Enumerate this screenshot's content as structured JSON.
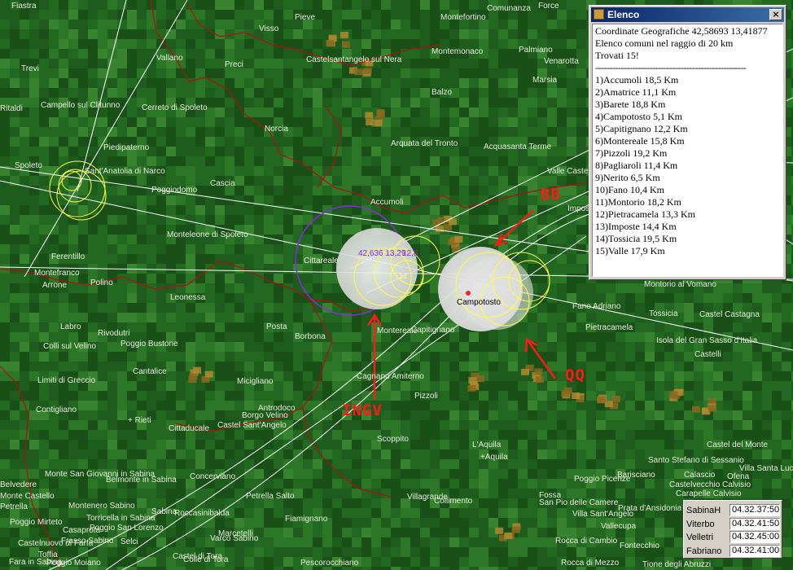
{
  "towns": [
    {
      "name": "Fiastra"
    },
    {
      "name": "Pieve"
    },
    {
      "name": "Visso"
    },
    {
      "name": "Montefortino"
    },
    {
      "name": "Comunanza"
    },
    {
      "name": "Force"
    },
    {
      "name": "Vallano"
    },
    {
      "name": "Preci"
    },
    {
      "name": "Castelsantangelo sul Nera"
    },
    {
      "name": "Montemonaco"
    },
    {
      "name": "Palmiano"
    },
    {
      "name": "Venarotta"
    },
    {
      "name": "Trevi"
    },
    {
      "name": "Marsia"
    },
    {
      "name": "Balzo"
    },
    {
      "name": "Ritaldi"
    },
    {
      "name": "Campello sul Clitunno"
    },
    {
      "name": "Cerreto di Spoleto"
    },
    {
      "name": "Norcia"
    },
    {
      "name": "Arquata del Tronto"
    },
    {
      "name": "Acquasanta Terme"
    },
    {
      "name": "Piedipaterno"
    },
    {
      "name": "Spoleto"
    },
    {
      "name": "Sant'Anatolia di Narco"
    },
    {
      "name": "Poggiodomo"
    },
    {
      "name": "Cascia"
    },
    {
      "name": "Valle Castellana"
    },
    {
      "name": "Accumoli"
    },
    {
      "name": "Imposte"
    },
    {
      "name": "Monteleone di Spoleto"
    },
    {
      "name": "Ferentillo"
    },
    {
      "name": "Cittareale"
    },
    {
      "name": "Montefranco"
    },
    {
      "name": "Arrone"
    },
    {
      "name": "Polino"
    },
    {
      "name": "Leonessa"
    },
    {
      "name": "Montorio al Vomano"
    },
    {
      "name": "Fano Adriano"
    },
    {
      "name": "Tossicia"
    },
    {
      "name": "Castel Castagna"
    },
    {
      "name": "Isola del Gran Sasso d'Italia"
    },
    {
      "name": "Castelli"
    },
    {
      "name": "Pietracamela"
    },
    {
      "name": "Posta"
    },
    {
      "name": "Borbona"
    },
    {
      "name": "Montereale"
    },
    {
      "name": "Capitignano"
    },
    {
      "name": "Labro"
    },
    {
      "name": "Rivodutri"
    },
    {
      "name": "Colli sul Velino"
    },
    {
      "name": "Poggio Bustone"
    },
    {
      "name": "Cantalice"
    },
    {
      "name": "Limiti di Greccio"
    },
    {
      "name": "Micigliano"
    },
    {
      "name": "Cagnano Amiterno"
    },
    {
      "name": "Pizzoli"
    },
    {
      "name": "Contigliano"
    },
    {
      "name": "+ Rieti"
    },
    {
      "name": "Antrodoco"
    },
    {
      "name": "Borgo Velino"
    },
    {
      "name": "Castel Sant'Angelo"
    },
    {
      "name": "Cittaducale"
    },
    {
      "name": "Scoppito"
    },
    {
      "name": "L'Aquila"
    },
    {
      "name": "+Aquila"
    },
    {
      "name": "Castel del Monte"
    },
    {
      "name": "Santo Stefano di Sessanio"
    },
    {
      "name": "Calascio"
    },
    {
      "name": "Ofena"
    },
    {
      "name": "Villa Santa Lucia"
    },
    {
      "name": "Castelvecchio Calvisio"
    },
    {
      "name": "Carapelle Calvisio"
    },
    {
      "name": "Barisciano"
    },
    {
      "name": "Poggio Picenze"
    },
    {
      "name": "Monte San Giovanni in Sabina"
    },
    {
      "name": "Belmonte in Sabina"
    },
    {
      "name": "Concerviano"
    },
    {
      "name": "Petrella Salto"
    },
    {
      "name": "Villagrande"
    },
    {
      "name": "Collimento"
    },
    {
      "name": "Fossa"
    },
    {
      "name": "San Pio delle Camere"
    },
    {
      "name": "Prata d'Ansidonia"
    },
    {
      "name": "Villa Sant'Angelo"
    },
    {
      "name": "Vallecupa"
    },
    {
      "name": "Fontecchio"
    },
    {
      "name": "Montenero Sabino"
    },
    {
      "name": "Torricella in Sabina"
    },
    {
      "name": "Roccasinibalda"
    },
    {
      "name": "Poggio San Lorenzo"
    },
    {
      "name": "Fiamignano"
    },
    {
      "name": "Marcetelli"
    },
    {
      "name": "Varco Sabino"
    },
    {
      "name": "Castel di Tora"
    },
    {
      "name": "Colle di Tora"
    },
    {
      "name": "Casaprota"
    },
    {
      "name": "Frasso Sabino"
    },
    {
      "name": "Castelnuovo di Farfa"
    },
    {
      "name": "Fara in Sabina"
    },
    {
      "name": "Toffia"
    },
    {
      "name": "Poggio Mirteto"
    },
    {
      "name": "Pescorocchiano"
    },
    {
      "name": "Rocca di Cambio"
    },
    {
      "name": "Rocca di Mezzo"
    },
    {
      "name": "Tione degli Abruzzi"
    },
    {
      "name": "Sabina"
    },
    {
      "name": "Selci"
    },
    {
      "name": "Poggio Moiano"
    },
    {
      "name": "Belvedere"
    },
    {
      "name": "Monte Castello"
    },
    {
      "name": "Petrella"
    }
  ],
  "overlay": {
    "coords_label": "42,636 13,29",
    "coords_label2": "12,8",
    "sub_label": "11",
    "campotosto_label": "Campotosto"
  },
  "annotations": {
    "bb": "BB",
    "qq": "QQ",
    "ingv": "INGV"
  },
  "window": {
    "title": "Elenco",
    "close": "×",
    "lines": [
      "Coordinate Geografiche 42,58693 13,41877",
      "Elenco comuni nel raggio di 20 km",
      "Trovati 15!",
      "-----------------------------------------------------",
      "1)Accumoli 18,5 Km",
      "2)Amatrice 11,1 Km",
      "3)Barete 18,8 Km",
      "4)Campotosto 5,1 Km",
      "5)Capitignano 12,2 Km",
      "6)Montereale 15,8 Km",
      "7)Pizzoli 19,2 Km",
      "8)Pagliaroli 11,4 Km",
      "9)Nerito 6,5 Km",
      "10)Fano 10,4 Km",
      "11)Montorio 18,2 Km",
      "12)Pietracamela 13,3 Km",
      "13)Imposte 14,4 Km",
      "14)Tossicia 19,5 Km",
      "15)Valle 17,9 Km"
    ]
  },
  "times": [
    {
      "name": "SabinaH",
      "value": "04.32.37:50"
    },
    {
      "name": "Viterbo",
      "value": "04.32.41:50"
    },
    {
      "name": "Velletri",
      "value": "04.32.45:00"
    },
    {
      "name": "Fabriano",
      "value": "04.32.41:00"
    }
  ],
  "colors": {
    "terrain_dark": "#0f4a14",
    "terrain_light": "#4f9a3c",
    "border": "#b01010",
    "annotation": "#ff1a1a",
    "circle_yellow": "#ffff40",
    "circle_purple": "#8a2be2"
  }
}
